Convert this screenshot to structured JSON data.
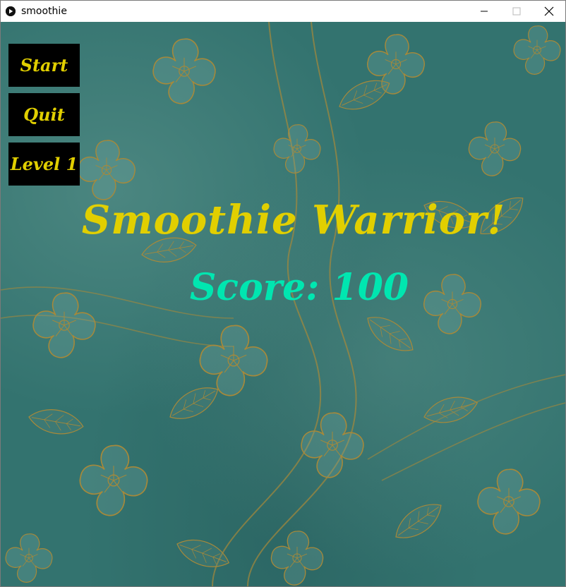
{
  "window": {
    "title": "smoothie"
  },
  "menu": {
    "start_label": "Start",
    "quit_label": "Quit",
    "level_label": "Level 1"
  },
  "game": {
    "title": "Smoothie Warrior!",
    "score_text": "Score: 100"
  },
  "colors": {
    "menu_text": "#e1cf00",
    "menu_bg": "#000000",
    "title_text": "#e1cf00",
    "score_text": "#00e6b0",
    "background": "#33736f",
    "floral_lines": "#a7893a"
  }
}
